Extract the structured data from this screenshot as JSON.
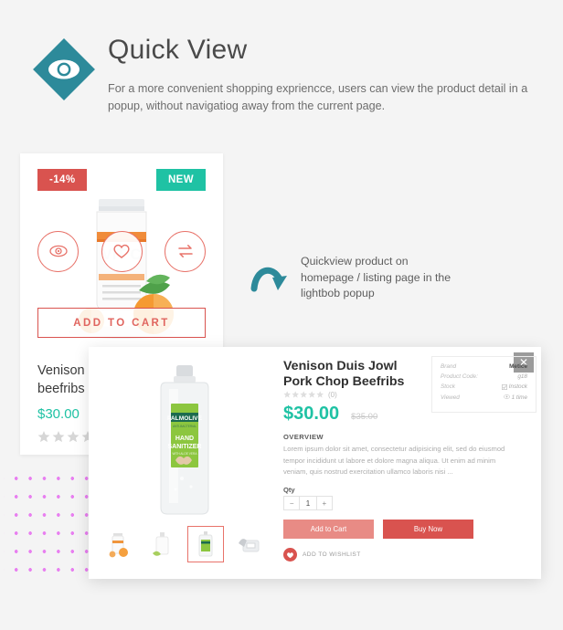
{
  "header": {
    "icon": "eye-icon",
    "title": "Quick View",
    "description": "For a more convenient shopping expriencce, users can view the product detail in a popup, without navigatiog away from the current page.",
    "accent_color": "#2d8a9a"
  },
  "product_card": {
    "sale_badge": "-14%",
    "new_badge": "NEW",
    "sale_badge_color": "#d9534f",
    "new_badge_color": "#1fc2a4",
    "actions": [
      {
        "name": "quick-view",
        "icon": "eye-icon"
      },
      {
        "name": "wishlist",
        "icon": "heart-icon"
      },
      {
        "name": "compare",
        "icon": "compare-arrows-icon"
      }
    ],
    "add_to_cart_label": "ADD TO CART",
    "title": "Venison Duis Jowl chop beefribs",
    "price": "$30.00",
    "price_color": "#1fc2a4",
    "rating": 4,
    "rating_max": 5,
    "image_alt": "vitamin-c-supplement-bottle"
  },
  "annotation": {
    "icon": "curved-arrow-icon",
    "text": "Quickview product on homepage / listing page in the lightbob popup",
    "arrow_color": "#2d8a9a"
  },
  "popup": {
    "close_label": "✕",
    "main_image_alt": "palmolive-hand-sanitizer-bottle",
    "thumbnails": [
      {
        "alt": "vitamin-c-supplement-bottle",
        "active": false
      },
      {
        "alt": "white-lotion-pump-bottle",
        "active": false
      },
      {
        "alt": "palmolive-hand-sanitizer-bottle",
        "active": true
      },
      {
        "alt": "blood-pressure-monitor",
        "active": false
      }
    ],
    "title": "Venison Duis Jowl Pork Chop Beefribs",
    "rating": 0,
    "rating_max": 5,
    "rating_count": "(0)",
    "price_now": "$30.00",
    "price_was": "$35.00",
    "price_now_color": "#1fc2a4",
    "info": [
      {
        "label": "Brand",
        "value": "Metice"
      },
      {
        "label": "Product Code:",
        "value": "g18"
      },
      {
        "label": "Stock",
        "value": "Instock",
        "icon": "check-square-icon"
      },
      {
        "label": "Viewed",
        "value": "1 time",
        "icon": "eye-icon"
      }
    ],
    "overview_label": "OVERVIEW",
    "overview_text": "Lorem ipsum dolor sit amet, consectetur adipisicing elit, sed do eiusmod tempor incididunt ut labore et dolore magna aliqua. Ut enim ad minim veniam, quis nostrud exercitation ullamco laboris nisi ...",
    "qty_label": "Qty",
    "qty_minus": "−",
    "qty_value": "1",
    "qty_plus": "+",
    "add_to_cart_label": "Add to Cart",
    "buy_now_label": "Buy Now",
    "add_to_cart_color": "#e88b85",
    "buy_now_color": "#d9534f",
    "wishlist_label": "ADD TO WISHLIST",
    "wishlist_icon": "heart-icon"
  }
}
